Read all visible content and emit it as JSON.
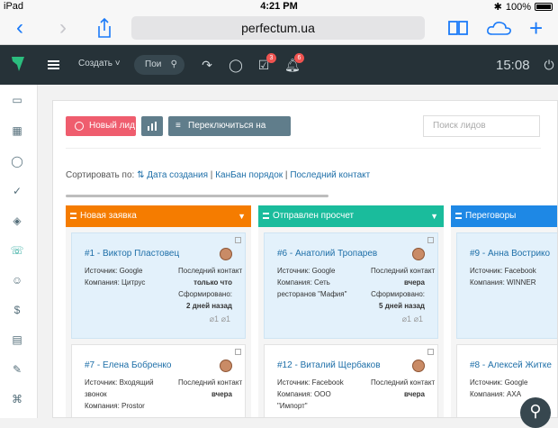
{
  "ios": {
    "device": "iPad",
    "time": "4:21 PM",
    "battery": "100%"
  },
  "safari": {
    "url": "perfectum.ua"
  },
  "topbar": {
    "create_label": "Создать",
    "search_placeholder": "Пои",
    "tasks_badge": "3",
    "notifications_badge": "6",
    "clock": "15:08"
  },
  "toolbar": {
    "new_lead": "Новый лид",
    "switch_to_list": "Переключиться на список",
    "search_placeholder": "Поиск лидов"
  },
  "sort": {
    "label": "Сортировать по:",
    "options": [
      "Дата создания",
      "КанБан порядок",
      "Последний контакт"
    ],
    "separator": "|"
  },
  "columns": [
    {
      "title": "Новая заявка",
      "color": "#f57c00",
      "cards": [
        {
          "title": "#1 - Виктор Пластовец",
          "source_label": "Источник: Google",
          "company_label": "Компания: Цитрус",
          "last_contact_label": "Последний контакт",
          "last_contact": "только что",
          "created_label": "Сформировано:",
          "created": "2 дней назад",
          "attachments": "1",
          "files": "1"
        },
        {
          "title": "#7 - Елена Бобренко",
          "source_label": "Источник: Входящий",
          "source_label2": "звонок",
          "company_label": "Компания: Prostor",
          "last_contact_label": "Последний контакт",
          "last_contact": "вчера"
        }
      ]
    },
    {
      "title": "Отправлен просчет",
      "color": "#1abc9c",
      "cards": [
        {
          "title": "#6 - Анатолий Тропарев",
          "source_label": "Источник: Google",
          "company_label": "Компания: Сеть",
          "company_label2": "ресторанов \"Мафия\"",
          "last_contact_label": "Последний контакт",
          "last_contact": "вчера",
          "created_label": "Сформировано:",
          "created": "5 дней назад",
          "attachments": "1",
          "files": "1"
        },
        {
          "title": "#12 - Виталий Щербаков",
          "source_label": "Источник: Facebook",
          "company_label": "Компания: ООО",
          "company_label2": "\"Импорт\"",
          "last_contact_label": "Последний контакт",
          "last_contact": "вчера"
        }
      ]
    },
    {
      "title": "Переговоры",
      "color": "#1e88e5",
      "cards": [
        {
          "title": "#9 - Анна Вострико",
          "source_label": "Источник: Facebook",
          "company_label": "Компания: WINNER"
        },
        {
          "title": "#8 - Алексей Житке",
          "source_label": "Источник: Google",
          "company_label": "Компания: AXA"
        }
      ]
    }
  ]
}
